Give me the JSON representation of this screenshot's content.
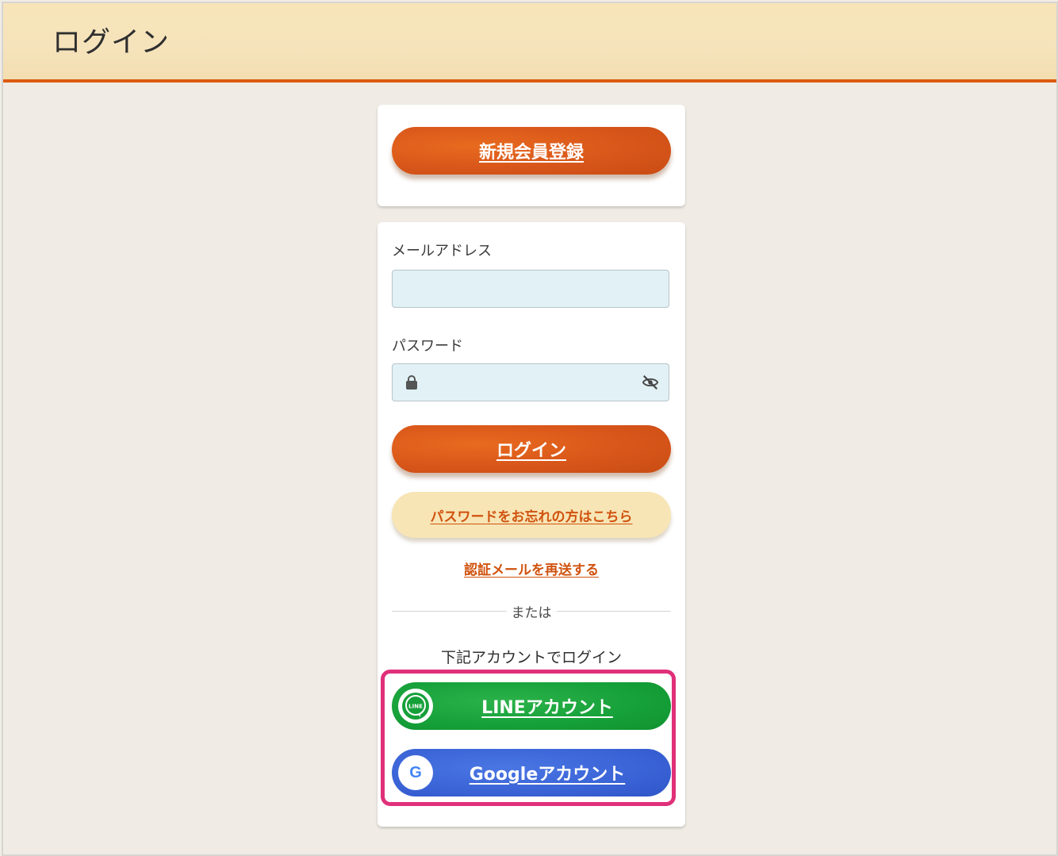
{
  "header": {
    "title": "ログイン"
  },
  "register": {
    "button_label": "新規会員登録"
  },
  "login_form": {
    "email_label": "メールアドレス",
    "email_value": "",
    "password_label": "パスワード",
    "password_value": "",
    "login_button_label": "ログイン",
    "forgot_password_label": "パスワードをお忘れの方はこちら",
    "resend_email_label": "認証メールを再送する",
    "divider_text": "または",
    "social_caption": "下記アカウントでログイン",
    "line_button_label": "LINEアカウント",
    "google_button_label": "Googleアカウント",
    "line_icon_text": "LINE",
    "google_icon_text": "G"
  },
  "colors": {
    "accent_orange": "#d8561a",
    "header_bg": "#f6e3b8",
    "input_bg": "#e1f1f5",
    "line_green": "#16a039",
    "google_blue": "#3a63d6",
    "highlight_pink": "#e0307a"
  },
  "icons": {
    "lock": "lock-icon",
    "eye": "eye-off-icon",
    "line": "line-icon",
    "google": "google-icon"
  }
}
